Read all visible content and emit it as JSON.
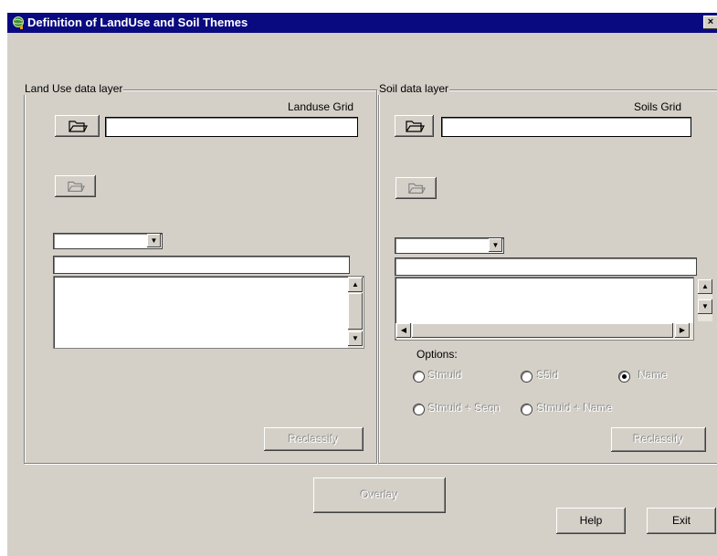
{
  "window": {
    "title": "Definition of LandUse and Soil Themes",
    "close_label": "×"
  },
  "landuse": {
    "group_label": "Land Use data layer",
    "grid_label": "Landuse Grid",
    "grid_value": "",
    "combo_value": "",
    "text_value": "",
    "reclassify_label": "Reclassify"
  },
  "soil": {
    "group_label": "Soil data layer",
    "grid_label": "Soils Grid",
    "grid_value": "",
    "combo_value": "",
    "text_value": "",
    "options_label": "Options:",
    "options": [
      {
        "label": "Stmuid",
        "selected": false
      },
      {
        "label": "S5id",
        "selected": false
      },
      {
        "label": "Name",
        "selected": true
      },
      {
        "label": "Stmuid + Seqn",
        "selected": false
      },
      {
        "label": "Stmuid + Name",
        "selected": false
      }
    ],
    "reclassify_label": "Reclassify"
  },
  "footer": {
    "overlay_label": "Overlay",
    "help_label": "Help",
    "exit_label": "Exit"
  },
  "colors": {
    "titlebar": "#0a0a80",
    "face": "#d4d0c8"
  },
  "icons": [
    "globe-app-icon",
    "open-folder-icon",
    "folder-disabled-icon",
    "dropdown-arrow-icon",
    "scroll-arrow-icon"
  ]
}
